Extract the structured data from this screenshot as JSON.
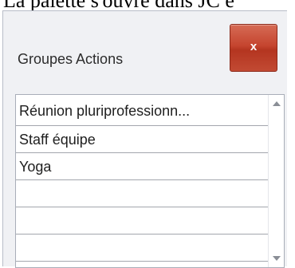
{
  "caption_text": "La palette s'ouvre dans JC e",
  "palette": {
    "title": "Groupes Actions",
    "close_label": "x",
    "close_color": "#c5452f"
  },
  "list": {
    "items": [
      {
        "label": "Réunion pluriprofessionn..."
      },
      {
        "label": "Staff équipe"
      },
      {
        "label": "Yoga"
      },
      {
        "label": ""
      },
      {
        "label": ""
      },
      {
        "label": ""
      }
    ]
  },
  "icons": {
    "close": "close-icon",
    "scroll_up": "scroll-up-arrow-icon",
    "scroll_down": "scroll-down-arrow-icon"
  }
}
